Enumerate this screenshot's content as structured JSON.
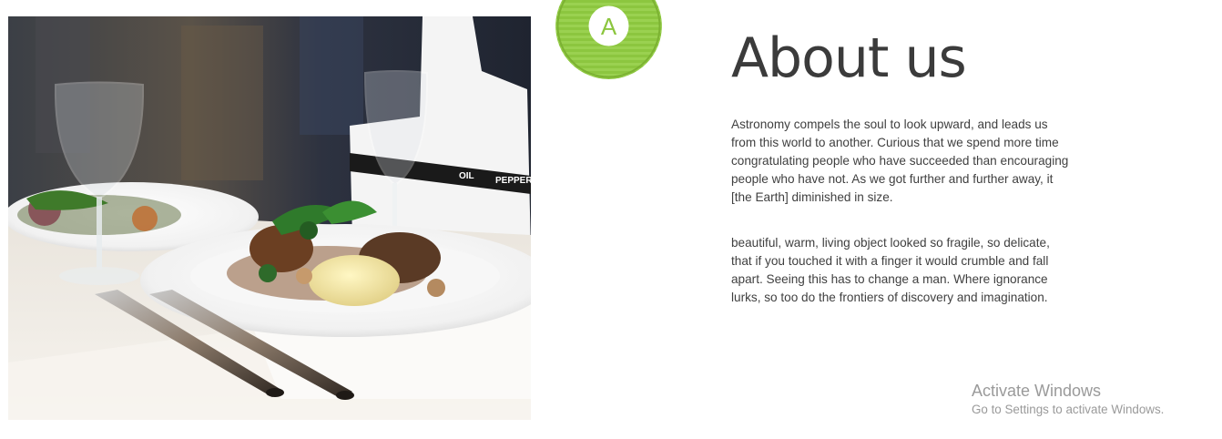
{
  "about": {
    "title": "About us",
    "paragraph_1": "Astronomy compels the soul to look upward, and leads us from this world to another. Curious that we spend more time congratulating people who have succeeded than encouraging people who have not. As we got further and further away, it [the Earth] diminished in size.",
    "paragraph_2": "beautiful, warm, living object looked so fragile, so delicate, that if you touched it with a finger it would crumble and fall apart. Seeing this has to change a man. Where ignorance lurks, so too do the frontiers of discovery and imagination."
  },
  "badge": {
    "letter": "A",
    "color": "#8cc63f"
  },
  "photo": {
    "label_oil": "OIL",
    "label_pepper": "PEPPER"
  },
  "windows_watermark": {
    "title": "Activate Windows",
    "subtitle": "Go to Settings to activate Windows."
  }
}
